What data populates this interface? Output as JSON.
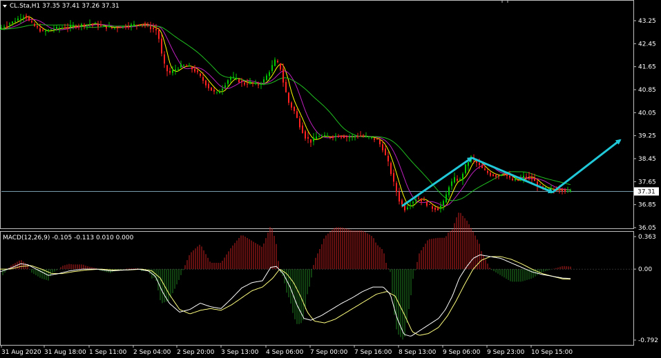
{
  "header": {
    "main_title": "CL.Sta,H1  37.35 37.41 37.26 37.31",
    "macd_title": "MACD(12,26,9) -0.105 -0.113 0.010 0.000"
  },
  "colors": {
    "background": "#000000",
    "frame": "#c0c0c0",
    "bull_candle": "#00c800",
    "bear_candle": "#ff2020",
    "fast_ma": "#ffff00",
    "mid_ma": "#c020c0",
    "slow_ma": "#20c020",
    "price_line": "#7aa0b0",
    "arrow": "#20c8d8",
    "macd_positive": "#c82020",
    "macd_negative": "#208020",
    "macd_line": "#ffffff",
    "signal_line": "#ffff80"
  },
  "chart_data": [
    {
      "type": "line",
      "description_kind": "candlestick_price_chart",
      "symbol_label": "CL.Sta,H1",
      "ohlc_last": {
        "open": 37.35,
        "high": 37.41,
        "low": 37.26,
        "close": 37.31
      },
      "ylim": [
        36.05,
        43.25
      ],
      "y_ticks": [
        "43.25",
        "42.45",
        "41.65",
        "40.85",
        "40.05",
        "39.25",
        "38.45",
        "37.65",
        "36.85",
        "36.05"
      ],
      "current_price_label": "37.31",
      "current_price": 37.31,
      "x_tick_labels": [
        "31 Aug 2020",
        "31 Aug 18:00",
        "1 Sep 11:00",
        "2 Sep 04:00",
        "2 Sep 20:00",
        "3 Sep 13:00",
        "4 Sep 06:00",
        "7 Sep 00:00",
        "7 Sep 16:00",
        "8 Sep 13:00",
        "9 Sep 06:00",
        "9 Sep 23:00",
        "10 Sep 15:00"
      ],
      "price_path": [
        [
          0,
          42.95
        ],
        [
          10,
          43.1
        ],
        [
          20,
          43.2
        ],
        [
          30,
          43.35
        ],
        [
          38,
          43.45
        ],
        [
          45,
          43.2
        ],
        [
          55,
          43.0
        ],
        [
          65,
          42.85
        ],
        [
          75,
          42.95
        ],
        [
          90,
          43.0
        ],
        [
          105,
          43.05
        ],
        [
          120,
          43.1
        ],
        [
          135,
          43.15
        ],
        [
          150,
          43.05
        ],
        [
          165,
          43.0
        ],
        [
          180,
          43.05
        ],
        [
          195,
          43.1
        ],
        [
          208,
          43.15
        ],
        [
          220,
          43.0
        ],
        [
          230,
          42.9
        ],
        [
          238,
          41.8
        ],
        [
          246,
          41.4
        ],
        [
          255,
          41.55
        ],
        [
          265,
          41.7
        ],
        [
          275,
          41.65
        ],
        [
          285,
          41.5
        ],
        [
          295,
          41.2
        ],
        [
          305,
          40.9
        ],
        [
          315,
          40.7
        ],
        [
          325,
          40.95
        ],
        [
          335,
          41.3
        ],
        [
          345,
          41.2
        ],
        [
          355,
          41.05
        ],
        [
          365,
          41.1
        ],
        [
          375,
          41.0
        ],
        [
          385,
          41.2
        ],
        [
          392,
          41.5
        ],
        [
          400,
          41.85
        ],
        [
          407,
          41.7
        ],
        [
          413,
          41.0
        ],
        [
          420,
          40.4
        ],
        [
          428,
          40.1
        ],
        [
          436,
          39.6
        ],
        [
          444,
          39.2
        ],
        [
          452,
          39.05
        ],
        [
          462,
          39.25
        ],
        [
          475,
          39.2
        ],
        [
          490,
          39.25
        ],
        [
          505,
          39.2
        ],
        [
          520,
          39.25
        ],
        [
          535,
          39.2
        ],
        [
          548,
          39.1
        ],
        [
          556,
          38.8
        ],
        [
          564,
          38.3
        ],
        [
          572,
          37.6
        ],
        [
          580,
          37.0
        ],
        [
          588,
          36.7
        ],
        [
          596,
          36.9
        ],
        [
          606,
          37.1
        ],
        [
          616,
          36.95
        ],
        [
          626,
          36.75
        ],
        [
          636,
          36.7
        ],
        [
          645,
          36.95
        ],
        [
          652,
          37.5
        ],
        [
          660,
          37.75
        ],
        [
          668,
          37.7
        ],
        [
          676,
          38.2
        ],
        [
          684,
          38.5
        ],
        [
          692,
          38.3
        ],
        [
          702,
          38.05
        ],
        [
          712,
          37.9
        ],
        [
          722,
          37.85
        ],
        [
          732,
          37.95
        ],
        [
          742,
          37.7
        ],
        [
          752,
          37.7
        ],
        [
          762,
          37.85
        ],
        [
          772,
          37.75
        ],
        [
          782,
          37.5
        ],
        [
          792,
          37.4
        ],
        [
          802,
          37.35
        ],
        [
          812,
          37.4
        ],
        [
          820,
          37.35
        ],
        [
          826,
          37.31
        ]
      ],
      "series": [
        {
          "key": "fast_ma",
          "lag": 2,
          "band": 0.08
        },
        {
          "key": "mid_ma",
          "lag": 5,
          "band": 0.15
        },
        {
          "key": "slow_ma",
          "lag": 14,
          "band": 0.35
        }
      ],
      "annotations": {
        "arrows": [
          [
            [
              582,
              36.8
            ],
            [
              683,
              38.48
            ]
          ],
          [
            [
              683,
              38.48
            ],
            [
              800,
              37.28
            ]
          ],
          [
            [
              800,
              37.28
            ],
            [
              898,
              39.1
            ]
          ]
        ]
      }
    },
    {
      "type": "bar",
      "description_kind": "macd_histogram_with_lines",
      "indicator_label": "MACD(12,26,9)",
      "values_printed": [
        -0.105,
        -0.113,
        0.01,
        0.0
      ],
      "ylim": [
        -0.792,
        0.363
      ],
      "y_ticks": [
        "0.363",
        "0.00",
        "-0.792"
      ],
      "macd_path": [
        [
          0,
          -0.03
        ],
        [
          15,
          0.01
        ],
        [
          30,
          0.06
        ],
        [
          40,
          0.05
        ],
        [
          55,
          -0.01
        ],
        [
          70,
          -0.07
        ],
        [
          85,
          -0.05
        ],
        [
          100,
          -0.02
        ],
        [
          120,
          0.0
        ],
        [
          140,
          0.0
        ],
        [
          160,
          -0.02
        ],
        [
          180,
          -0.01
        ],
        [
          200,
          0.0
        ],
        [
          215,
          -0.02
        ],
        [
          225,
          -0.08
        ],
        [
          235,
          -0.25
        ],
        [
          245,
          -0.38
        ],
        [
          260,
          -0.48
        ],
        [
          275,
          -0.45
        ],
        [
          290,
          -0.38
        ],
        [
          305,
          -0.42
        ],
        [
          320,
          -0.44
        ],
        [
          335,
          -0.33
        ],
        [
          350,
          -0.21
        ],
        [
          365,
          -0.15
        ],
        [
          380,
          -0.13
        ],
        [
          392,
          0.02
        ],
        [
          400,
          0.03
        ],
        [
          410,
          -0.05
        ],
        [
          420,
          -0.2
        ],
        [
          430,
          -0.4
        ],
        [
          440,
          -0.55
        ],
        [
          450,
          -0.57
        ],
        [
          465,
          -0.52
        ],
        [
          480,
          -0.45
        ],
        [
          495,
          -0.38
        ],
        [
          510,
          -0.32
        ],
        [
          525,
          -0.25
        ],
        [
          540,
          -0.2
        ],
        [
          555,
          -0.2
        ],
        [
          565,
          -0.28
        ],
        [
          575,
          -0.55
        ],
        [
          585,
          -0.73
        ],
        [
          595,
          -0.75
        ],
        [
          605,
          -0.7
        ],
        [
          615,
          -0.65
        ],
        [
          625,
          -0.6
        ],
        [
          635,
          -0.55
        ],
        [
          645,
          -0.45
        ],
        [
          655,
          -0.3
        ],
        [
          665,
          -0.1
        ],
        [
          675,
          0.02
        ],
        [
          685,
          0.12
        ],
        [
          695,
          0.16
        ],
        [
          710,
          0.14
        ],
        [
          725,
          0.12
        ],
        [
          740,
          0.07
        ],
        [
          755,
          0.02
        ],
        [
          770,
          -0.03
        ],
        [
          785,
          -0.06
        ],
        [
          800,
          -0.08
        ],
        [
          815,
          -0.1
        ],
        [
          826,
          -0.105
        ]
      ],
      "signal_path": [
        [
          0,
          0.0
        ],
        [
          15,
          0.0
        ],
        [
          30,
          0.03
        ],
        [
          45,
          0.04
        ],
        [
          60,
          0.0
        ],
        [
          75,
          -0.05
        ],
        [
          90,
          -0.05
        ],
        [
          105,
          -0.03
        ],
        [
          125,
          -0.01
        ],
        [
          145,
          0.0
        ],
        [
          165,
          -0.01
        ],
        [
          185,
          -0.01
        ],
        [
          205,
          0.0
        ],
        [
          220,
          -0.02
        ],
        [
          232,
          -0.1
        ],
        [
          245,
          -0.28
        ],
        [
          260,
          -0.45
        ],
        [
          275,
          -0.5
        ],
        [
          290,
          -0.46
        ],
        [
          305,
          -0.44
        ],
        [
          320,
          -0.46
        ],
        [
          335,
          -0.4
        ],
        [
          350,
          -0.32
        ],
        [
          365,
          -0.24
        ],
        [
          380,
          -0.2
        ],
        [
          395,
          -0.1
        ],
        [
          405,
          0.0
        ],
        [
          415,
          -0.05
        ],
        [
          425,
          -0.15
        ],
        [
          435,
          -0.3
        ],
        [
          445,
          -0.48
        ],
        [
          455,
          -0.58
        ],
        [
          470,
          -0.6
        ],
        [
          485,
          -0.56
        ],
        [
          500,
          -0.49
        ],
        [
          515,
          -0.42
        ],
        [
          530,
          -0.35
        ],
        [
          545,
          -0.28
        ],
        [
          560,
          -0.25
        ],
        [
          572,
          -0.3
        ],
        [
          585,
          -0.5
        ],
        [
          597,
          -0.7
        ],
        [
          607,
          -0.74
        ],
        [
          620,
          -0.72
        ],
        [
          635,
          -0.65
        ],
        [
          648,
          -0.52
        ],
        [
          660,
          -0.36
        ],
        [
          672,
          -0.18
        ],
        [
          685,
          0.0
        ],
        [
          697,
          0.1
        ],
        [
          710,
          0.14
        ],
        [
          725,
          0.14
        ],
        [
          740,
          0.11
        ],
        [
          755,
          0.06
        ],
        [
          770,
          0.0
        ],
        [
          785,
          -0.05
        ],
        [
          800,
          -0.08
        ],
        [
          815,
          -0.11
        ],
        [
          826,
          -0.113
        ]
      ]
    }
  ]
}
